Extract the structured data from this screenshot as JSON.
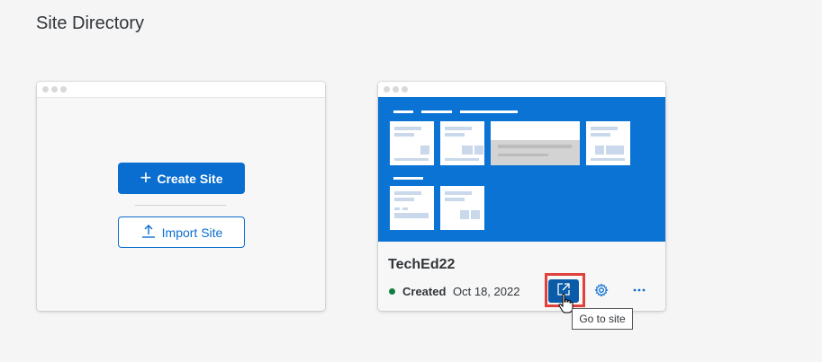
{
  "page": {
    "title": "Site Directory"
  },
  "create_card": {
    "create_label": "Create Site",
    "import_label": "Import Site"
  },
  "site_card": {
    "name": "TechEd22",
    "status": "Created",
    "status_color": "#107e3e",
    "date": "Oct 18, 2022",
    "actions": {
      "go_icon": "external-link-icon",
      "settings_icon": "gear-icon",
      "more_icon": "more-icon"
    },
    "tooltip": "Go to site"
  },
  "colors": {
    "accent": "#0a6ed1",
    "preview_bg": "#0a73d4",
    "highlight": "#e0413b"
  }
}
